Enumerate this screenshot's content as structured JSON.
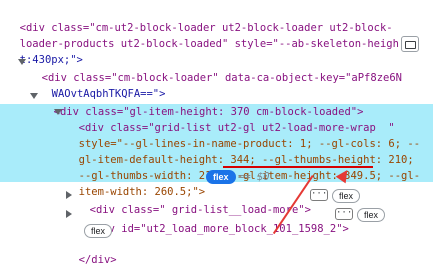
{
  "lines": [
    "<div class=\"cm-ut2-block-loader ut2-block-loader ut2-block-",
    "loader-products ut2-block-loaded\" style=\"--ab-skeleton-heigh",
    "t:430px;\">",
    "<div class=\"cm-block-loader\" data-ca-object-key=\"aPf8ze6N",
    "WAOvtAqbhTKQFA==\">",
    "<div class=\"gl-item-height: 370 cm-block-loaded\">",
    "<div class=\"grid-list ut2-gl ut2-load-more-wrap  \"",
    "style=\"--gl-lines-in-name-product: 1; --gl-cols: 6; --",
    "gl-item-default-height: 344; --gl-thumbs-height: 210;",
    "--gl-thumbs-width: 210; --gl-item-height: 349.5; --gl-",
    "item-width: 260.5;\">",
    "<div class=\" grid-list__load-more\">",
    "<div id=\"ut2_load_more_block_101_1598_2\">",
    "</div>"
  ],
  "badges": {
    "flex_main": "flex",
    "eq": "== $0",
    "flex_load_more": "flex",
    "flex_block": "flex",
    "flex_bottom": "flex"
  },
  "dots": "···"
}
